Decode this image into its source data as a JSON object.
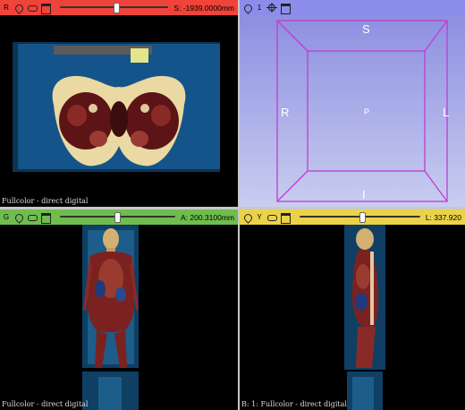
{
  "views": {
    "red": {
      "label": "R",
      "slider_value": 0.52,
      "offset_text": "S: -1939.0000mm",
      "footer_text": "Fullcolor - direct digital",
      "header_color": "#f0433a"
    },
    "threed": {
      "count_label": "1",
      "orientation": {
        "top": "S",
        "bottom": "I",
        "left": "R",
        "right": "L",
        "center": "P"
      },
      "header_color": "#8c8dea"
    },
    "green": {
      "label": "G",
      "slider_value": 0.5,
      "offset_text": "A: 200.3100mm",
      "footer_text": "Fullcolor - direct digital",
      "header_color": "#6ebd4d"
    },
    "yellow": {
      "label": "Y",
      "slider_value": 0.52,
      "offset_text": "L: 337.920",
      "footer_text": "B: 1: Fullcolor - direct digital",
      "header_color": "#ecd248"
    }
  },
  "icons": {
    "pin": "pin-icon",
    "link": "link-icon",
    "window": "view-controller-icon",
    "center": "center-view-icon"
  }
}
